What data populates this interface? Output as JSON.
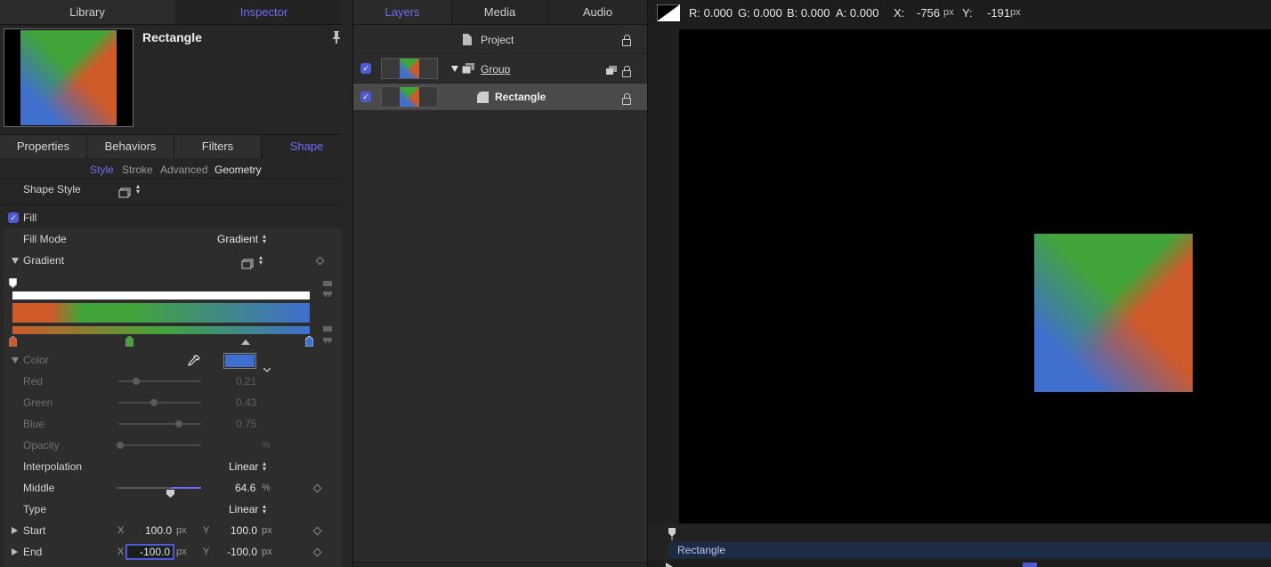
{
  "left_tabs": {
    "library": "Library",
    "inspector": "Inspector"
  },
  "object": {
    "name": "Rectangle"
  },
  "inspector_tabs": [
    "Properties",
    "Behaviors",
    "Filters",
    "Shape"
  ],
  "shape_subtabs": [
    "Style",
    "Stroke",
    "Advanced",
    "Geometry"
  ],
  "shape_style": {
    "label": "Shape Style"
  },
  "fill": {
    "label": "Fill"
  },
  "fill_mode": {
    "label": "Fill Mode",
    "value": "Gradient"
  },
  "gradient": {
    "label": "Gradient"
  },
  "color_section": {
    "label": "Color",
    "swatch": "#3f6fcf"
  },
  "red": {
    "label": "Red",
    "value": "0.21",
    "level": 0.21
  },
  "green": {
    "label": "Green",
    "value": "0.43",
    "level": 0.43
  },
  "blue": {
    "label": "Blue",
    "value": "0.75",
    "level": 0.75
  },
  "opacity": {
    "label": "Opacity",
    "unit": "%"
  },
  "interpolation": {
    "label": "Interpolation",
    "value": "Linear"
  },
  "middle": {
    "label": "Middle",
    "value": "64.6",
    "unit": "%",
    "level": 0.646
  },
  "type": {
    "label": "Type",
    "value": "Linear"
  },
  "start": {
    "label": "Start",
    "x_label": "X",
    "x": "100.0",
    "y_label": "Y",
    "y": "100.0",
    "unit": "px"
  },
  "end": {
    "label": "End",
    "x_label": "X",
    "x": "-100.0",
    "y_label": "Y",
    "y": "-100.0",
    "unit": "px"
  },
  "mid_tabs": {
    "layers": "Layers",
    "media": "Media",
    "audio": "Audio"
  },
  "layers": {
    "project": "Project",
    "group": "Group",
    "rectangle": "Rectangle"
  },
  "color_readout": {
    "r": "R: 0.000",
    "g": "G: 0.000",
    "b": "B: 0.000",
    "a": "A: 0.000"
  },
  "coord_readout": {
    "x_label": "X:",
    "x": "-756",
    "x_unit": "px",
    "y_label": "Y:",
    "y": "-191",
    "y_unit": "px"
  },
  "timeline": {
    "clip_label": "Rectangle"
  },
  "colors": {
    "accent": "#6b6df5",
    "gradient_orange": "#cf5a2a",
    "gradient_green": "#42a53a",
    "gradient_blue": "#3f6fcf"
  }
}
